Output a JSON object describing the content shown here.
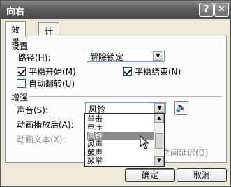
{
  "window": {
    "title": "向右",
    "help_label": "?",
    "close_label": "✕"
  },
  "tabs": [
    {
      "label": "效果"
    },
    {
      "label": "计时"
    }
  ],
  "settings": {
    "section_title": "设置",
    "path_label": "路径(H):",
    "path_value": "解除锁定",
    "smooth_start_label": "平稳开始(M)",
    "smooth_start_checked": true,
    "smooth_end_label": "平稳结束(N)",
    "smooth_end_checked": true,
    "auto_reverse_label": "自动翻转(U)",
    "auto_reverse_checked": false
  },
  "enhance": {
    "section_title": "增强",
    "sound_label": "声音(S):",
    "sound_value": "风铃",
    "after_anim_label": "动画播放后(A):",
    "anim_text_label": "动画文本(X):",
    "delay_label_fragment": "之间延迟(D)",
    "sound_options": [
      "单击",
      "电压",
      "风铃",
      "风声",
      "鼓声",
      "鼓掌"
    ],
    "selected_option": "风铃"
  },
  "buttons": {
    "ok": "确定",
    "cancel": "取消"
  },
  "icons": {
    "speaker": "speaker-icon",
    "dropdown": "chevron-down-icon",
    "cursor": "mouse-pointer-icon"
  }
}
